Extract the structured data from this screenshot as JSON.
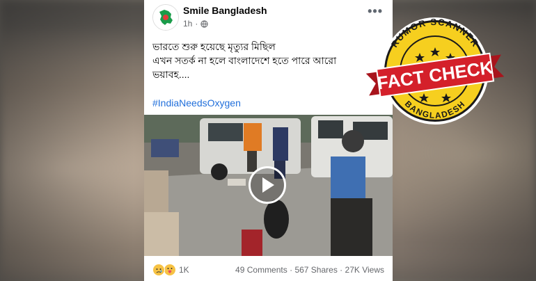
{
  "post": {
    "page_name": "Smile Bangladesh",
    "time": "1h",
    "text_line1": "ভারতে শুরু হয়েছে মৃত্যুর মিছিল",
    "text_line2": "এখন সতর্ক না হলে বাংলাদেশে হতে পারে আরো",
    "text_line3": "ভয়াবহ....",
    "hashtag": "#IndiaNeedsOxygen",
    "reaction_count": "1K",
    "comments": "49 Comments",
    "shares": "567 Shares",
    "views": "27K Views"
  },
  "stamp": {
    "top_text": "RUMOR SCANNER",
    "banner_text": "FACT CHECK",
    "bottom_text": "BANGLADESH"
  },
  "colors": {
    "stamp_yellow": "#f6cf1f",
    "stamp_red": "#d4202a",
    "link_blue": "#216fdb"
  },
  "icons": [
    "globe-icon",
    "more-icon",
    "play-icon",
    "sad-reaction-icon",
    "care-reaction-icon"
  ]
}
